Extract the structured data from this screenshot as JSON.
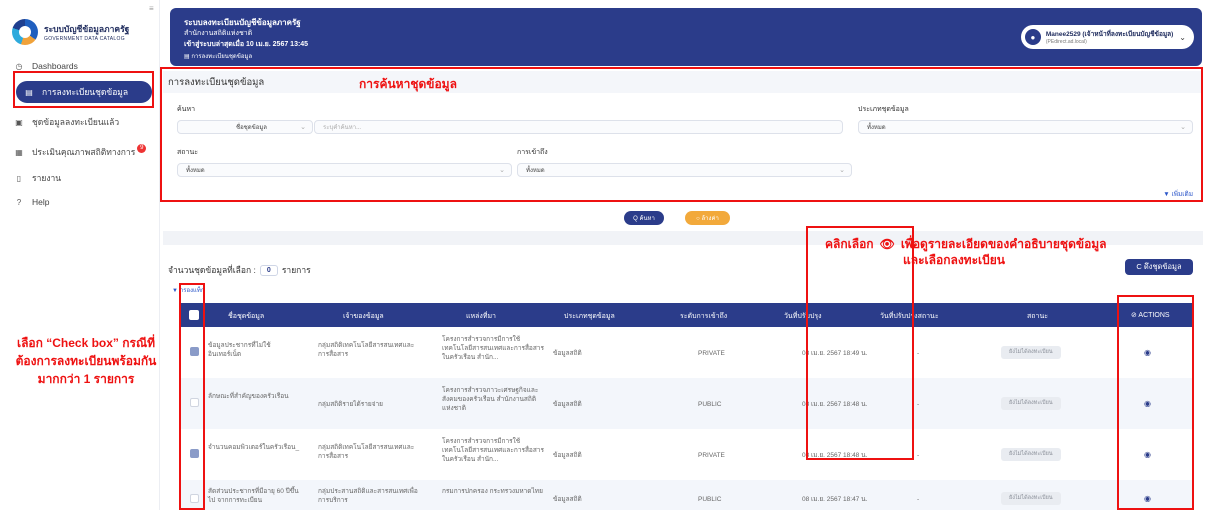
{
  "sidebar": {
    "logo_title": "ระบบบัญชีข้อมูลภาครัฐ",
    "logo_sub": "GOVERNMENT DATA CATALOG",
    "items": [
      {
        "label": "Dashboards",
        "icon": "dashboard-icon"
      },
      {
        "label": "การลงทะเบียนชุดข้อมูล",
        "icon": "register-icon"
      },
      {
        "label": "ชุดข้อมูลลงทะเบียนแล้ว",
        "icon": "dataset-icon"
      },
      {
        "label": "ประเมินคุณภาพสถิติทางการ",
        "icon": "grid-icon",
        "badge": "9"
      },
      {
        "label": "รายงาน",
        "icon": "report-icon"
      },
      {
        "label": "Help",
        "icon": "help-icon"
      }
    ]
  },
  "header": {
    "line1": "ระบบลงทะเบียนบัญชีข้อมูลภาครัฐ",
    "line2": "สำนักงานสถิติแห่งชาติ",
    "line3": "เข้าสู่ระบบล่าสุดเมื่อ 10 เม.ย. 2567 13:45",
    "breadcrumb": "การลงทะเบียนชุดข้อมูล",
    "user_name": "Manee2529 (เจ้าหน้าที่ลงทะเบียนบัญชีข้อมูล)",
    "user_email": "(PEdirect.ad.local)"
  },
  "search": {
    "panel_title": "การลงทะเบียนชุดข้อมูล",
    "search_label": "ค้นหา",
    "search_by_value": "ชื่อชุดข้อมูล",
    "search_placeholder": "ระบุคำค้นหา...",
    "type_label": "ประเภทชุดข้อมูล",
    "type_value": "ทั้งหมด",
    "status_label": "สถานะ",
    "status_value": "ทั้งหมด",
    "access_label": "การเข้าถึง",
    "access_value": "ทั้งหมด",
    "more": "▼ เพิ่มเติม",
    "search_btn": "Q ค้นหา",
    "clear_btn": "○ ล้างค่า"
  },
  "table": {
    "count_label": "จำนวนชุดข้อมูลที่เลือก :",
    "count_value": "0",
    "count_unit": "รายการ",
    "filter_label": "▼ กรองแท็ก",
    "fetch_btn": "C ดึงชุดข้อมูล",
    "columns": [
      "ชื่อชุดข้อมูล",
      "เจ้าของข้อมูล",
      "แหล่งที่มา",
      "ประเภทชุดข้อมูล",
      "ระดับการเข้าถึง",
      "วันที่ปรับปรุง",
      "วันที่ปรับปรุงสถานะ",
      "สถานะ",
      "⊘ ACTIONS"
    ],
    "rows": [
      {
        "name": "ข้อมูลประชากรที่ไม่ใช้อินเทอร์เน็ต",
        "owner": "กลุ่มสถิติเทคโนโลยีสารสนเทศและการสื่อสาร",
        "source": "โครงการสำรวจการมีการใช้เทคโนโลยีสารสนเทศและการสื่อสารในครัวเรือน สำนัก...",
        "type": "ข้อมูลสถิติ",
        "level": "PRIVATE",
        "date": "08 เม.ย. 2567 18:49 น.",
        "status_date": "-",
        "status": "ยังไม่ได้ลงทะเบียน",
        "checked": true
      },
      {
        "name": "ลักษณะที่สำคัญของครัวเรือน",
        "owner": "กลุ่มสถิติรายได้รายจ่าย",
        "source": "โครงการสำรวจภาวะเศรษฐกิจและสังคมของครัวเรือน สำนักงานสถิติแห่งชาติ",
        "type": "ข้อมูลสถิติ",
        "level": "PUBLIC",
        "date": "08 เม.ย. 2567 18:48 น.",
        "status_date": "-",
        "status": "ยังไม่ได้ลงทะเบียน",
        "checked": false
      },
      {
        "name": "จำนวนคอมพิวเตอร์ในครัวเรือน_",
        "owner": "กลุ่มสถิติเทคโนโลยีสารสนเทศและการสื่อสาร",
        "source": "โครงการสำรวจการมีการใช้เทคโนโลยีสารสนเทศและการสื่อสารในครัวเรือน สำนัก...",
        "type": "ข้อมูลสถิติ",
        "level": "PRIVATE",
        "date": "08 เม.ย. 2567 18:48 น.",
        "status_date": "-",
        "status": "ยังไม่ได้ลงทะเบียน",
        "checked": true
      },
      {
        "name": "สัดส่วนประชากรที่มีอายุ 60 ปีขึ้นไป จากการทะเบียน",
        "owner": "กลุ่มประสานสถิติและสารสนเทศเพื่อการบริการ",
        "source": "กรมการปกครอง กระทรวงมหาดไทย",
        "type": "ข้อมูลสถิติ",
        "level": "PUBLIC",
        "date": "08 เม.ย. 2567 18:47 น.",
        "status_date": "-",
        "status": "ยังไม่ได้ลงทะเบียน",
        "checked": false
      }
    ]
  },
  "annotations": {
    "search_title": "การค้นหาชุดข้อมูล",
    "click_line1_a": "คลิกเลือก",
    "click_line1_b": "เพื่อดูรายละเอียดของคำอธิบายชุดข้อมูล",
    "click_line2": "และเลือกลงทะเบียน",
    "left_note": "เลือก “Check box” กรณีที่ต้องการลงทะเบียนพร้อมกันมากกว่า 1 รายการ",
    "color": "#ee1111"
  },
  "theme": {
    "primary": "#2b3c8a",
    "accent": "#f2a93b"
  }
}
